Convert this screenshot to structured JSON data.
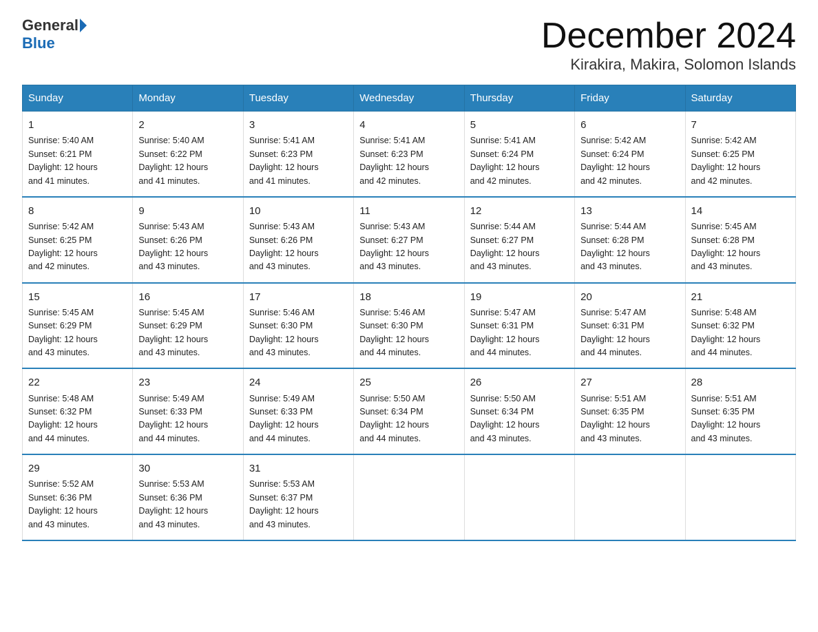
{
  "logo": {
    "text_general": "General",
    "text_blue": "Blue"
  },
  "header": {
    "month": "December 2024",
    "location": "Kirakira, Makira, Solomon Islands"
  },
  "weekdays": [
    "Sunday",
    "Monday",
    "Tuesday",
    "Wednesday",
    "Thursday",
    "Friday",
    "Saturday"
  ],
  "weeks": [
    [
      {
        "day": "1",
        "sunrise": "5:40 AM",
        "sunset": "6:21 PM",
        "daylight": "12 hours and 41 minutes."
      },
      {
        "day": "2",
        "sunrise": "5:40 AM",
        "sunset": "6:22 PM",
        "daylight": "12 hours and 41 minutes."
      },
      {
        "day": "3",
        "sunrise": "5:41 AM",
        "sunset": "6:23 PM",
        "daylight": "12 hours and 41 minutes."
      },
      {
        "day": "4",
        "sunrise": "5:41 AM",
        "sunset": "6:23 PM",
        "daylight": "12 hours and 42 minutes."
      },
      {
        "day": "5",
        "sunrise": "5:41 AM",
        "sunset": "6:24 PM",
        "daylight": "12 hours and 42 minutes."
      },
      {
        "day": "6",
        "sunrise": "5:42 AM",
        "sunset": "6:24 PM",
        "daylight": "12 hours and 42 minutes."
      },
      {
        "day": "7",
        "sunrise": "5:42 AM",
        "sunset": "6:25 PM",
        "daylight": "12 hours and 42 minutes."
      }
    ],
    [
      {
        "day": "8",
        "sunrise": "5:42 AM",
        "sunset": "6:25 PM",
        "daylight": "12 hours and 42 minutes."
      },
      {
        "day": "9",
        "sunrise": "5:43 AM",
        "sunset": "6:26 PM",
        "daylight": "12 hours and 43 minutes."
      },
      {
        "day": "10",
        "sunrise": "5:43 AM",
        "sunset": "6:26 PM",
        "daylight": "12 hours and 43 minutes."
      },
      {
        "day": "11",
        "sunrise": "5:43 AM",
        "sunset": "6:27 PM",
        "daylight": "12 hours and 43 minutes."
      },
      {
        "day": "12",
        "sunrise": "5:44 AM",
        "sunset": "6:27 PM",
        "daylight": "12 hours and 43 minutes."
      },
      {
        "day": "13",
        "sunrise": "5:44 AM",
        "sunset": "6:28 PM",
        "daylight": "12 hours and 43 minutes."
      },
      {
        "day": "14",
        "sunrise": "5:45 AM",
        "sunset": "6:28 PM",
        "daylight": "12 hours and 43 minutes."
      }
    ],
    [
      {
        "day": "15",
        "sunrise": "5:45 AM",
        "sunset": "6:29 PM",
        "daylight": "12 hours and 43 minutes."
      },
      {
        "day": "16",
        "sunrise": "5:45 AM",
        "sunset": "6:29 PM",
        "daylight": "12 hours and 43 minutes."
      },
      {
        "day": "17",
        "sunrise": "5:46 AM",
        "sunset": "6:30 PM",
        "daylight": "12 hours and 43 minutes."
      },
      {
        "day": "18",
        "sunrise": "5:46 AM",
        "sunset": "6:30 PM",
        "daylight": "12 hours and 44 minutes."
      },
      {
        "day": "19",
        "sunrise": "5:47 AM",
        "sunset": "6:31 PM",
        "daylight": "12 hours and 44 minutes."
      },
      {
        "day": "20",
        "sunrise": "5:47 AM",
        "sunset": "6:31 PM",
        "daylight": "12 hours and 44 minutes."
      },
      {
        "day": "21",
        "sunrise": "5:48 AM",
        "sunset": "6:32 PM",
        "daylight": "12 hours and 44 minutes."
      }
    ],
    [
      {
        "day": "22",
        "sunrise": "5:48 AM",
        "sunset": "6:32 PM",
        "daylight": "12 hours and 44 minutes."
      },
      {
        "day": "23",
        "sunrise": "5:49 AM",
        "sunset": "6:33 PM",
        "daylight": "12 hours and 44 minutes."
      },
      {
        "day": "24",
        "sunrise": "5:49 AM",
        "sunset": "6:33 PM",
        "daylight": "12 hours and 44 minutes."
      },
      {
        "day": "25",
        "sunrise": "5:50 AM",
        "sunset": "6:34 PM",
        "daylight": "12 hours and 44 minutes."
      },
      {
        "day": "26",
        "sunrise": "5:50 AM",
        "sunset": "6:34 PM",
        "daylight": "12 hours and 43 minutes."
      },
      {
        "day": "27",
        "sunrise": "5:51 AM",
        "sunset": "6:35 PM",
        "daylight": "12 hours and 43 minutes."
      },
      {
        "day": "28",
        "sunrise": "5:51 AM",
        "sunset": "6:35 PM",
        "daylight": "12 hours and 43 minutes."
      }
    ],
    [
      {
        "day": "29",
        "sunrise": "5:52 AM",
        "sunset": "6:36 PM",
        "daylight": "12 hours and 43 minutes."
      },
      {
        "day": "30",
        "sunrise": "5:53 AM",
        "sunset": "6:36 PM",
        "daylight": "12 hours and 43 minutes."
      },
      {
        "day": "31",
        "sunrise": "5:53 AM",
        "sunset": "6:37 PM",
        "daylight": "12 hours and 43 minutes."
      },
      null,
      null,
      null,
      null
    ]
  ],
  "labels": {
    "sunrise": "Sunrise:",
    "sunset": "Sunset:",
    "daylight": "Daylight:"
  }
}
